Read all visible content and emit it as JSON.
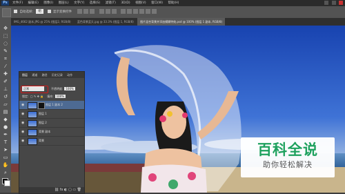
{
  "menubar": {
    "logo": "Ps",
    "menus": [
      "文件(F)",
      "编辑(E)",
      "图像(I)",
      "图层(L)",
      "文字(Y)",
      "选择(S)",
      "滤镜(T)",
      "3D(D)",
      "视图(V)",
      "窗口(W)",
      "帮助(H)"
    ]
  },
  "options": {
    "auto_select": "自动选择：",
    "auto_select_value": "组",
    "transform": "显示变换控件"
  },
  "tabs": [
    "IMG_4662 副本.JPG @ 25% (图层2, RGB/8)",
    "蓝色背景蓝天.jpg @ 33.3% (图层 1, RGB/8)",
    "图片混合背景并添加模糊特效.psd @ 100% (图层 1 副本, RGB/8)"
  ],
  "layers_panel": {
    "tabs": [
      "图层",
      "通道",
      "路径",
      "历史记录",
      "动作"
    ],
    "blend_mode": "正常",
    "opacity_label": "不透明度:",
    "opacity_value": "100%",
    "lock_label": "锁定:",
    "fill_label": "填充:",
    "fill_value": "100%",
    "layers": [
      {
        "name": "图层 1 副本 2",
        "mask": true
      },
      {
        "name": "图层 1",
        "mask": false
      },
      {
        "name": "图层 2",
        "mask": false
      },
      {
        "name": "背景 副本",
        "mask": false
      },
      {
        "name": "背景",
        "mask": false
      }
    ],
    "footer_icons": "⛓ fx ◐ ▢ ▭ 🗑"
  },
  "watermark": {
    "title": "百科全说",
    "subtitle": "助你轻松解决"
  },
  "colors": {
    "sky": "#1e4fb8",
    "selected_layer": "#4d6a93",
    "highlight": "#d81818",
    "watermark_green": "#1ea15e"
  }
}
